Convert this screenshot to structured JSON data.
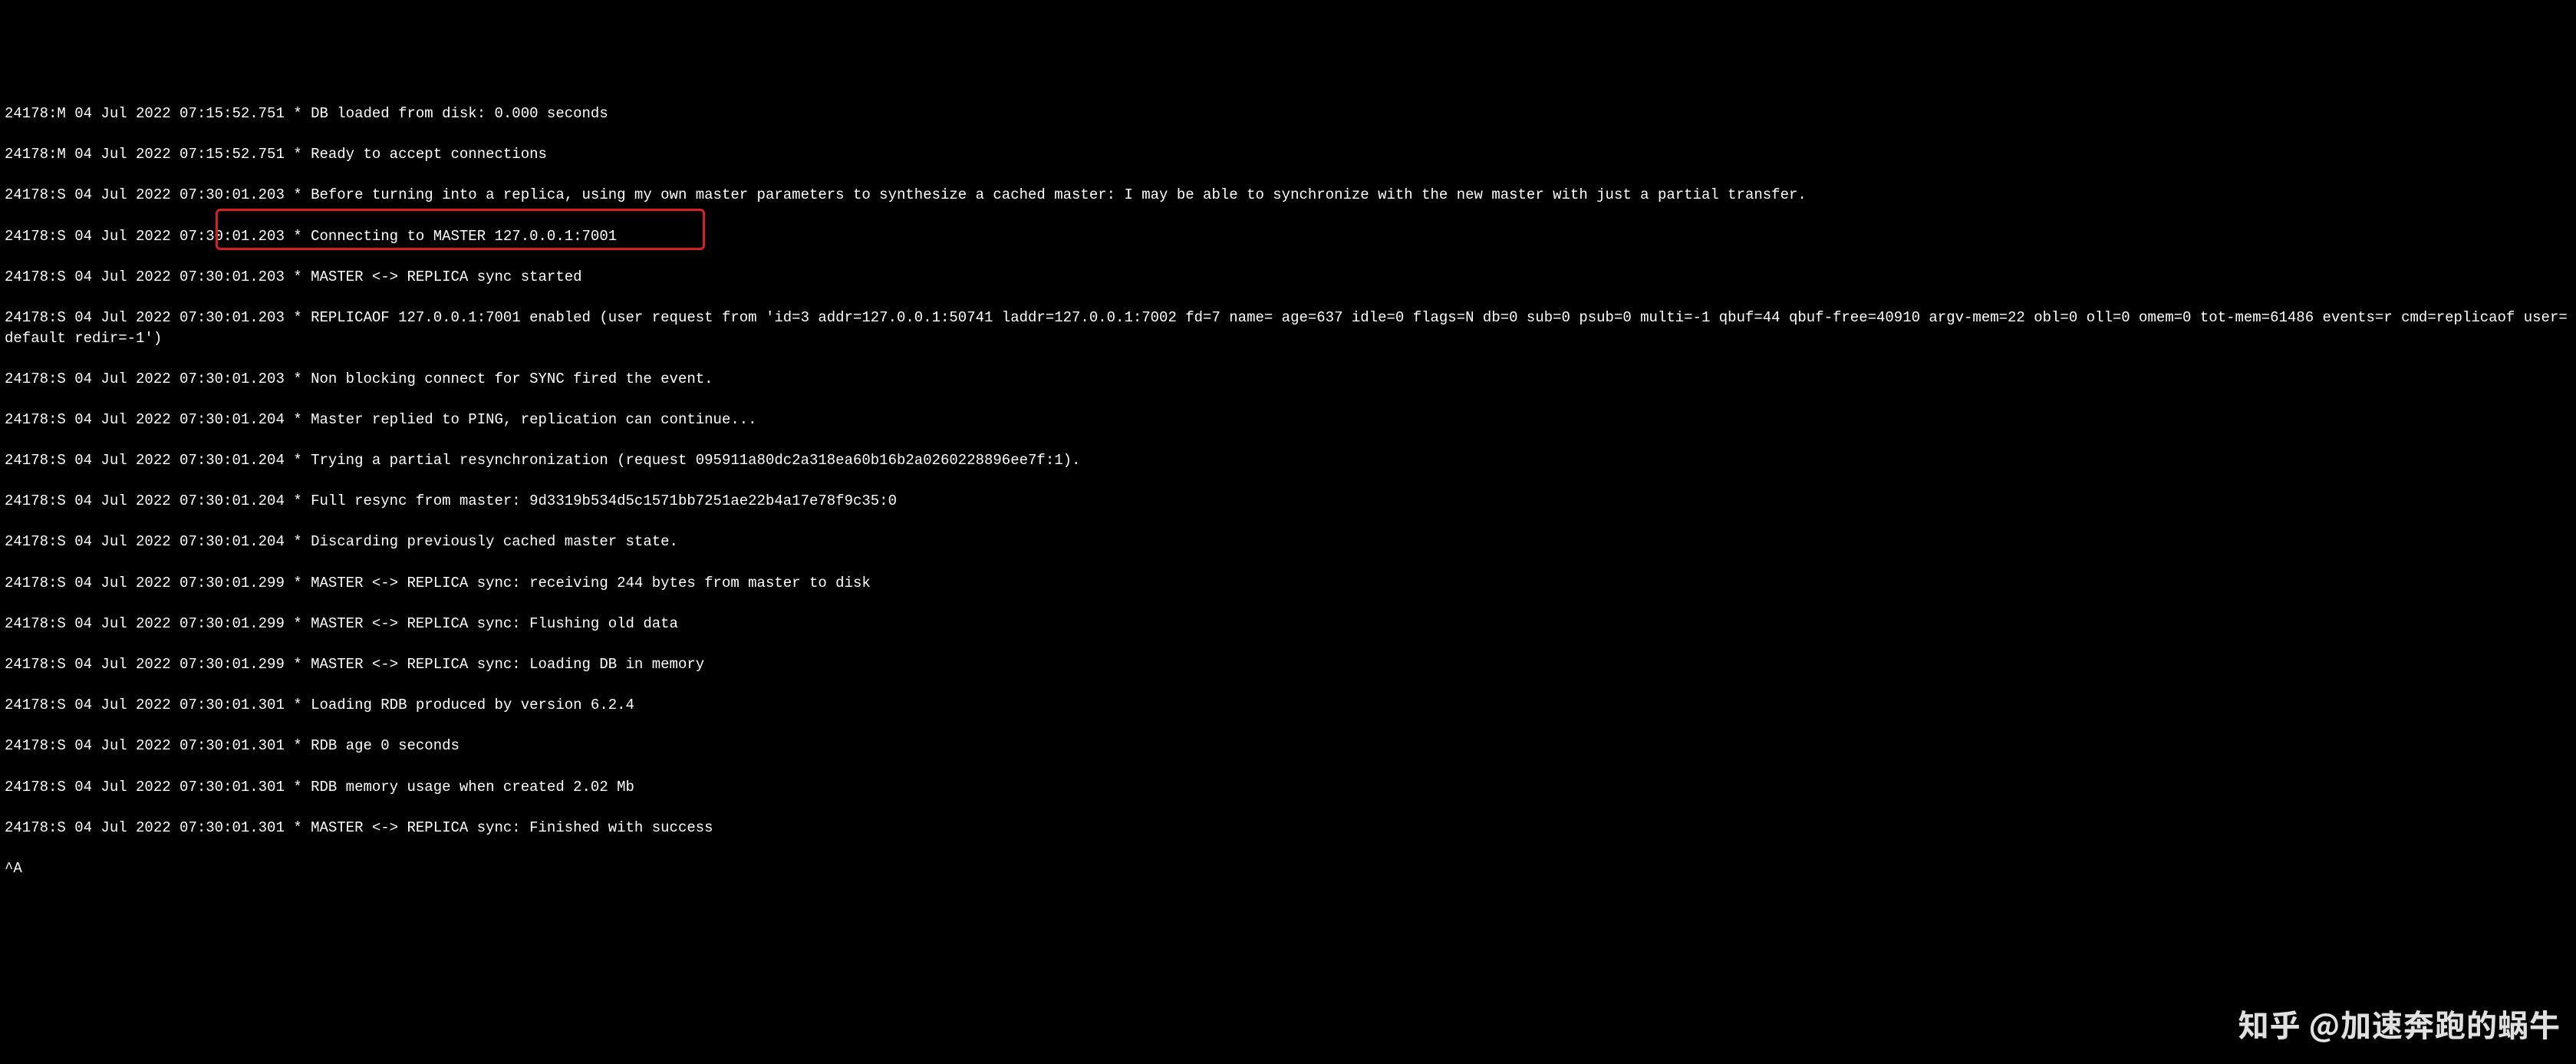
{
  "log": {
    "lines": [
      "24178:M 04 Jul 2022 07:15:52.751 * DB loaded from disk: 0.000 seconds",
      "24178:M 04 Jul 2022 07:15:52.751 * Ready to accept connections",
      "24178:S 04 Jul 2022 07:30:01.203 * Before turning into a replica, using my own master parameters to synthesize a cached master: I may be able to synchronize with the new master with just a partial transfer.",
      "24178:S 04 Jul 2022 07:30:01.203 * Connecting to MASTER 127.0.0.1:7001",
      "24178:S 04 Jul 2022 07:30:01.203 * MASTER <-> REPLICA sync started",
      "24178:S 04 Jul 2022 07:30:01.203 * REPLICAOF 127.0.0.1:7001 enabled (user request from 'id=3 addr=127.0.0.1:50741 laddr=127.0.0.1:7002 fd=7 name= age=637 idle=0 flags=N db=0 sub=0 psub=0 multi=-1 qbuf=44 qbuf-free=40910 argv-mem=22 obl=0 oll=0 omem=0 tot-mem=61486 events=r cmd=replicaof user=default redir=-1')",
      "24178:S 04 Jul 2022 07:30:01.203 * Non blocking connect for SYNC fired the event.",
      "24178:S 04 Jul 2022 07:30:01.204 * Master replied to PING, replication can continue...",
      "24178:S 04 Jul 2022 07:30:01.204 * Trying a partial resynchronization (request 095911a80dc2a318ea60b16b2a0260228896ee7f:1).",
      "24178:S 04 Jul 2022 07:30:01.204 * Full resync from master: 9d3319b534d5c1571bb7251ae22b4a17e78f9c35:0",
      "24178:S 04 Jul 2022 07:30:01.204 * Discarding previously cached master state.",
      "24178:S 04 Jul 2022 07:30:01.299 * MASTER <-> REPLICA sync: receiving 244 bytes from master to disk",
      "24178:S 04 Jul 2022 07:30:01.299 * MASTER <-> REPLICA sync: Flushing old data",
      "24178:S 04 Jul 2022 07:30:01.299 * MASTER <-> REPLICA sync: Loading DB in memory",
      "24178:S 04 Jul 2022 07:30:01.301 * Loading RDB produced by version 6.2.4",
      "24178:S 04 Jul 2022 07:30:01.301 * RDB age 0 seconds",
      "24178:S 04 Jul 2022 07:30:01.301 * RDB memory usage when created 2.02 Mb",
      "24178:S 04 Jul 2022 07:30:01.301 * MASTER <-> REPLICA sync: Finished with success"
    ],
    "cursor": "^A"
  },
  "watermark": "知乎 @加速奔跑的蜗牛"
}
